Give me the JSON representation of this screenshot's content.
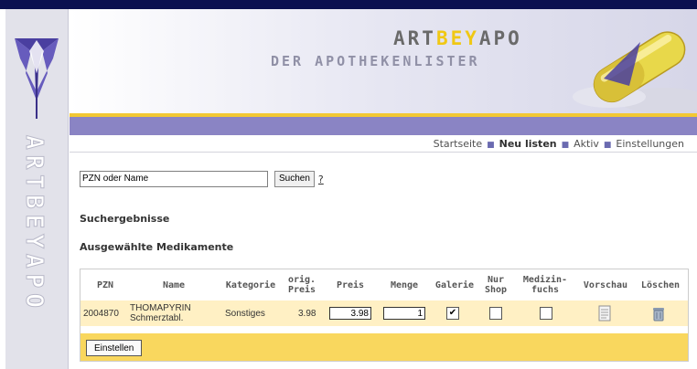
{
  "brand": {
    "part1": "ART",
    "part2": "BEY",
    "part3": "APO",
    "subtitle": "DER APOTHEKENLISTER",
    "vertical_text": "ARTBEYAPO"
  },
  "colors": {
    "top_bar": "#0b1050",
    "purple_bar": "#8a84c4",
    "gold": "#f2c833",
    "row_highlight": "#fff0c4",
    "footer_bar": "#f9d75e"
  },
  "nav": {
    "items": [
      {
        "label": "Startseite",
        "active": false
      },
      {
        "label": "Neu listen",
        "active": true
      },
      {
        "label": "Aktiv",
        "active": false
      },
      {
        "label": "Einstellungen",
        "active": false
      }
    ]
  },
  "search": {
    "value": "PZN oder Name",
    "button": "Suchen",
    "help": "?"
  },
  "headings": {
    "results": "Suchergebnisse",
    "selected": "Ausgewählte Medikamente"
  },
  "table": {
    "headers": {
      "pzn": "PZN",
      "name": "Name",
      "kategorie": "Kategorie",
      "orig_preis": "orig. Preis",
      "preis": "Preis",
      "menge": "Menge",
      "galerie": "Galerie",
      "nur_shop": "Nur Shop",
      "medizinfuchs": "Medizin-fuchs",
      "vorschau": "Vorschau",
      "loeschen": "Löschen"
    },
    "rows": [
      {
        "pzn": "2004870",
        "name": "THOMAPYRIN Schmerztabl.",
        "kategorie": "Sonstiges",
        "orig_preis": "3.98",
        "preis": "3.98",
        "menge": "1",
        "galerie": true,
        "nur_shop": false,
        "medizinfuchs": false,
        "vorschau_icon": "document-icon",
        "loeschen_icon": "trash-icon"
      }
    ],
    "footer_button": "Einstellen"
  }
}
